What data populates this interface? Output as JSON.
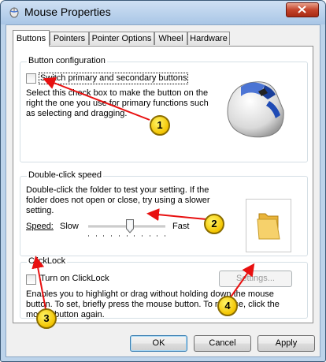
{
  "window": {
    "title": "Mouse Properties",
    "icon": "mouse-icon",
    "close_icon": "close-icon"
  },
  "tabs": [
    {
      "label": "Buttons",
      "active": true
    },
    {
      "label": "Pointers",
      "active": false
    },
    {
      "label": "Pointer Options",
      "active": false
    },
    {
      "label": "Wheel",
      "active": false
    },
    {
      "label": "Hardware",
      "active": false
    }
  ],
  "button_config": {
    "group_label": "Button configuration",
    "checkbox_label": "Switch primary and secondary buttons",
    "checked": false,
    "description": [
      "Select this check box to make the button on the",
      "right the one you use for primary functions such",
      "as selecting and dragging."
    ]
  },
  "double_click": {
    "group_label": "Double-click speed",
    "description": [
      "Double-click the folder to test your setting. If the",
      "folder does not open or close, try using a slower",
      "setting."
    ],
    "speed_label": "Speed:",
    "slow_label": "Slow",
    "fast_label": "Fast",
    "slider_level": 0.55
  },
  "clicklock": {
    "group_label": "ClickLock",
    "checkbox_label": "Turn on ClickLock",
    "checked": false,
    "settings_label": "Settings...",
    "description": [
      "Enables you to highlight or drag without holding down the mouse",
      "button. To set, briefly press the mouse button. To release, click the",
      "mouse button again."
    ]
  },
  "footer": {
    "ok_label": "OK",
    "cancel_label": "Cancel",
    "apply_label": "Apply"
  },
  "callouts": [
    "1",
    "2",
    "3",
    "4"
  ],
  "colors": {
    "arrow": "#e81010",
    "callout_fill": "#f3c400",
    "title_bar": "#bcd3ea"
  }
}
